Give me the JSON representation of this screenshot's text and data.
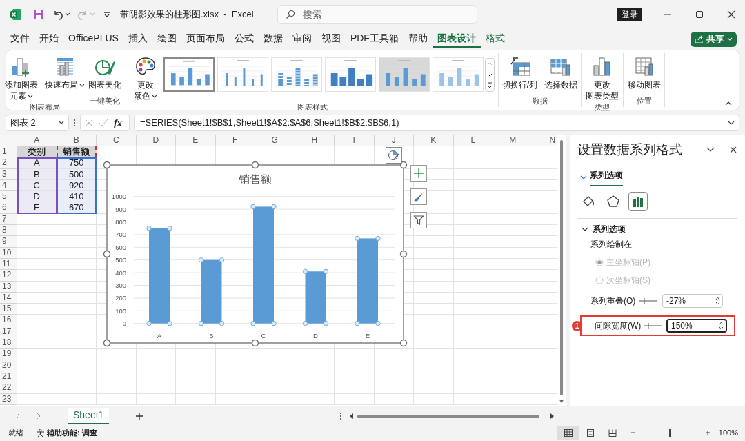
{
  "title_bar": {
    "title": "带阴影效果的柱形图.xlsx  -  Excel",
    "search": {
      "placeholder": "搜索"
    },
    "sign_in": "登录"
  },
  "ribbon_tabs": [
    {
      "label": "文件",
      "selected": false,
      "contextual": false
    },
    {
      "label": "开始",
      "selected": false,
      "contextual": false
    },
    {
      "label": "OfficePLUS",
      "selected": false,
      "contextual": false
    },
    {
      "label": "插入",
      "selected": false,
      "contextual": false
    },
    {
      "label": "绘图",
      "selected": false,
      "contextual": false
    },
    {
      "label": "页面布局",
      "selected": false,
      "contextual": false
    },
    {
      "label": "公式",
      "selected": false,
      "contextual": false
    },
    {
      "label": "数据",
      "selected": false,
      "contextual": false
    },
    {
      "label": "审阅",
      "selected": false,
      "contextual": false
    },
    {
      "label": "视图",
      "selected": false,
      "contextual": false
    },
    {
      "label": "PDF工具箱",
      "selected": false,
      "contextual": false
    },
    {
      "label": "帮助",
      "selected": false,
      "contextual": false
    },
    {
      "label": "图表设计",
      "selected": true,
      "contextual": true
    },
    {
      "label": "格式",
      "selected": false,
      "contextual": true
    }
  ],
  "share_button": {
    "label": "共享"
  },
  "ribbon_groups": [
    {
      "label": "图表布局",
      "commands": [
        {
          "kind": "add-element",
          "lines": [
            "添加图表",
            "元素"
          ],
          "dropdown": true
        },
        {
          "kind": "quick-layout",
          "lines": [
            "快速布局"
          ],
          "dropdown": true
        }
      ]
    },
    {
      "label": "一键美化",
      "commands": [
        {
          "kind": "beautify",
          "lines": [
            "图表美化"
          ],
          "dropdown": false
        }
      ]
    },
    {
      "label": "图表样式",
      "commands": [
        {
          "kind": "palette",
          "lines": [
            "更改",
            "颜色"
          ],
          "dropdown": true
        }
      ],
      "styles": [
        {
          "selected": true
        },
        {
          "selected": false
        },
        {
          "selected": false
        },
        {
          "selected": false
        },
        {
          "selected": false
        },
        {
          "selected": false
        }
      ]
    },
    {
      "label": "数据",
      "commands": [
        {
          "kind": "switch",
          "lines": [
            "切换行/列"
          ],
          "dropdown": false
        },
        {
          "kind": "select-data",
          "lines": [
            "选择数据"
          ],
          "dropdown": false
        }
      ]
    },
    {
      "label": "类型",
      "commands": [
        {
          "kind": "change-type",
          "lines": [
            "更改",
            "图表类型"
          ],
          "dropdown": false
        }
      ]
    },
    {
      "label": "位置",
      "commands": [
        {
          "kind": "move",
          "lines": [
            "移动图表"
          ],
          "dropdown": false
        }
      ]
    }
  ],
  "formula_bar": {
    "name_box": "图表 2",
    "function_button": "fx",
    "formula": "=SERIES(Sheet1!$B$1,Sheet1!$A$2:$A$6,Sheet1!$B$2:$B$6,1)"
  },
  "sheet": {
    "columns": [
      "A",
      "B",
      "C",
      "D",
      "E",
      "F",
      "G",
      "H",
      "I",
      "J",
      "K",
      "L",
      "M",
      "N"
    ],
    "rows": [
      "1",
      "2",
      "3",
      "4",
      "5",
      "6",
      "7",
      "8",
      "9",
      "10",
      "11",
      "12",
      "13",
      "14",
      "15",
      "16",
      "17",
      "18",
      "19",
      "20",
      "21",
      "22",
      "23"
    ],
    "cells": [
      [
        "类别",
        "销售额"
      ],
      [
        "A",
        "750"
      ],
      [
        "B",
        "500"
      ],
      [
        "C",
        "920"
      ],
      [
        "D",
        "410"
      ],
      [
        "E",
        "670"
      ]
    ]
  },
  "chart": {
    "selected": true,
    "chart_data": {
      "type": "bar",
      "title": "销售额",
      "categories": [
        "A",
        "B",
        "C",
        "D",
        "E"
      ],
      "series": [
        {
          "color": "#5b9bd5",
          "values": [
            750,
            500,
            920,
            410,
            670
          ]
        }
      ],
      "grid": true,
      "ylim": [
        0,
        1000
      ],
      "yticks": [
        0,
        100,
        200,
        300,
        400,
        500,
        600,
        700,
        800,
        900,
        1000
      ]
    }
  },
  "format_pane": {
    "title": "设置数据系列格式",
    "tab": {
      "label": "系列选项",
      "selected": true
    },
    "icon_tabs": [
      {
        "kind": "fill",
        "selected": false
      },
      {
        "kind": "effects",
        "selected": false
      },
      {
        "kind": "series",
        "selected": true
      }
    ],
    "section": {
      "label": "系列选项",
      "expanded": true
    },
    "plot_on_label": "系列绘制在",
    "radios": [
      {
        "label": "主坐标轴(P)",
        "selected": true,
        "disabled": true
      },
      {
        "label": "次坐标轴(S)",
        "selected": false,
        "disabled": true
      }
    ],
    "spinners": [
      {
        "label": "系列重叠(O)",
        "value": "-27%",
        "focused": false,
        "highlighted": false
      },
      {
        "label": "间隙宽度(W)",
        "value": "150%",
        "focused": true,
        "highlighted": true,
        "badge": "1"
      }
    ]
  },
  "sheet_tabs": [
    {
      "label": "Sheet1",
      "selected": true
    }
  ],
  "status_bar": {
    "ready": "就绪",
    "accessibility": "辅助功能: 调查",
    "views": [
      {
        "kind": "normal",
        "selected": true
      },
      {
        "kind": "page-layout",
        "selected": false
      },
      {
        "kind": "page-break",
        "selected": false
      }
    ],
    "zoom": {
      "level": 0.5
    },
    "zoom_label": "100%"
  }
}
